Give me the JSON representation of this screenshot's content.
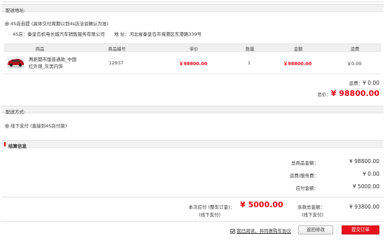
{
  "delivery": {
    "section_title": "配送地址:",
    "option_label": "4S店自提 (具体交付周期以到4s店洽谈确认为准)",
    "dealer_name": "4S店：秦皇岛机电长城汽车销售服务有限公司",
    "address_label": "地  址：",
    "address": "河北省秦皇岛市海港区东港路339号"
  },
  "table": {
    "headers": [
      "商品",
      "商品编号",
      "单价",
      "数量",
      "金额",
      "运费"
    ],
    "row": {
      "product_name_line1": "两驱都市版普通款_中国",
      "product_name_line2": "红外观_灰黑内饰",
      "product_id": "12937",
      "unit_price": "￥98800.00",
      "quantity": "1",
      "amount": "￥98800.00",
      "shipping": "￥0.00"
    }
  },
  "totals": {
    "shipping_label": "运费：",
    "shipping_value": "¥ 0.00",
    "total_label": "总价：",
    "total_value": "¥ 98800.00"
  },
  "payment": {
    "section_title": "配送方式:",
    "option_label": "线下支付 (直接到4S店付款)"
  },
  "settlement": {
    "section_title": "结算信息",
    "goods_total_label": "总商品金额：",
    "goods_total_value": "¥ 98800.00",
    "fee_label": "运费/服务费：",
    "fee_value": "¥ 0.00",
    "payable_label": "应付金额：",
    "payable_value": "¥ 5000.00",
    "deposit_label": "本次应付 (整车订金)：",
    "deposit_note": "(线下支付)",
    "deposit_value": "¥ 5000.00",
    "balance_label": "余款总金额：",
    "balance_note": "(线下支付)",
    "balance_value": "¥ 93800.00"
  },
  "footer": {
    "agree_label": "我已阅读，并同意购车协议",
    "back_button": "返回修改",
    "submit_button": "提交订单"
  },
  "colors": {
    "accent_red": "#e60012",
    "submit_bg": "#e8121d"
  }
}
